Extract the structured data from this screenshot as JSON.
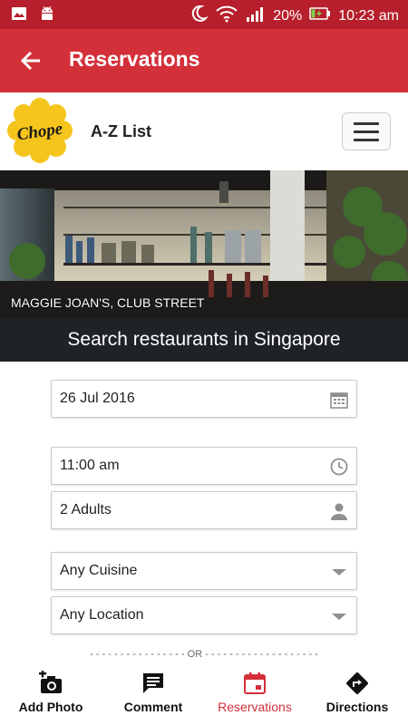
{
  "status_bar": {
    "battery": "20%",
    "time": "10:23 am"
  },
  "app_bar": {
    "title": "Reservations"
  },
  "brand": {
    "logo_text": "Chope",
    "az_list": "A-Z List"
  },
  "hero": {
    "caption": "MAGGIE JOAN'S, CLUB STREET"
  },
  "search_title": "Search restaurants in Singapore",
  "form": {
    "date": "26 Jul 2016",
    "time": "11:00 am",
    "guests": "2 Adults",
    "cuisine": "Any Cuisine",
    "location": "Any Location",
    "or_divider": "OR"
  },
  "bottom_nav": {
    "items": [
      {
        "label": "Add Photo",
        "icon": "add-photo-icon"
      },
      {
        "label": "Comment",
        "icon": "comment-icon"
      },
      {
        "label": "Reservations",
        "icon": "calendar-icon",
        "active": true
      },
      {
        "label": "Directions",
        "icon": "directions-icon"
      }
    ]
  },
  "colors": {
    "primary": "#d3303a",
    "status_bar": "#b61f2b",
    "logo_yellow": "#f6c51c",
    "banner": "#1f2327"
  }
}
